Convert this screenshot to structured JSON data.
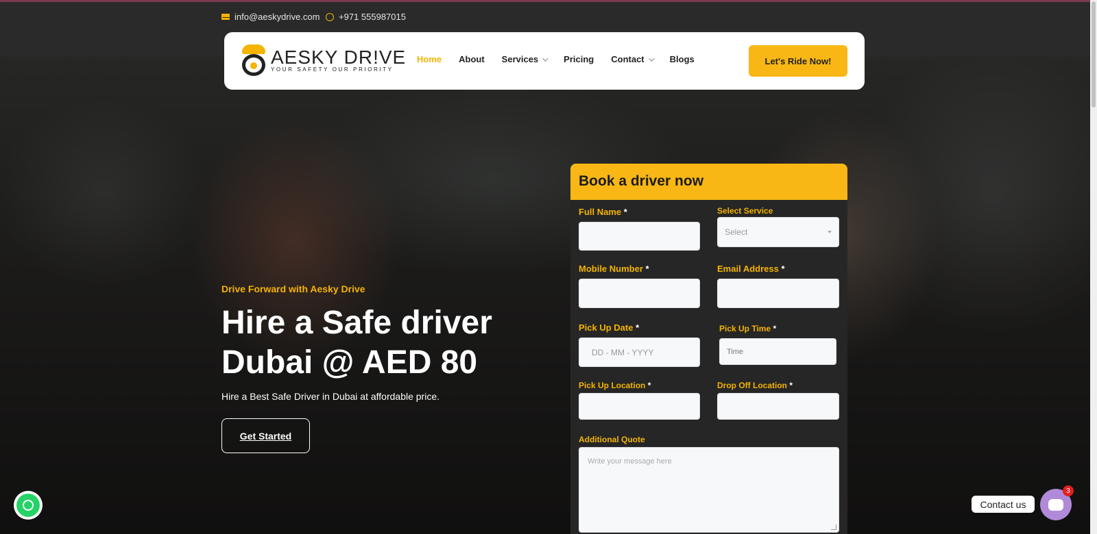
{
  "topbar": {
    "email": "info@aeskydrive.com",
    "phone": "+971 555987015"
  },
  "brand": {
    "name": "AESKY DR!VE",
    "tagline": "YOUR SAFETY OUR PRIORITY"
  },
  "nav": {
    "items": [
      {
        "label": "Home",
        "active": true
      },
      {
        "label": "About"
      },
      {
        "label": "Services"
      },
      {
        "label": "Pricing"
      },
      {
        "label": "Contact"
      },
      {
        "label": "Blogs"
      }
    ],
    "cta": "Let's Ride Now!"
  },
  "hero": {
    "eyebrow": "Drive Forward with Aesky Drive",
    "headline": "Hire a Safe driver Dubai @ AED 80",
    "subtitle": "Hire a Best Safe Driver in Dubai at affordable price.",
    "button": "Get Started"
  },
  "form": {
    "title": "Book a driver now",
    "required_mark": "*",
    "full_name": {
      "label": "Full Name"
    },
    "select_service": {
      "label": "Select Service",
      "value": "Select"
    },
    "mobile": {
      "label": "Mobile Number"
    },
    "email": {
      "label": "Email Address"
    },
    "pickup_date": {
      "label": "Pick Up Date",
      "placeholder": "DD - MM - YYYY"
    },
    "pickup_time": {
      "label": "Pick Up Time",
      "placeholder": "Time"
    },
    "pickup_location": {
      "label": "Pick Up Location"
    },
    "dropoff_location": {
      "label": "Drop Off Location"
    },
    "additional": {
      "label": "Additional Quote",
      "placeholder": "Write your message here"
    }
  },
  "floating": {
    "contact_label": "Contact us",
    "badge_count": "3"
  },
  "colors": {
    "accent": "#f8b714",
    "form_bg": "#262626",
    "chat": "#b08ad8",
    "whatsapp": "#25d366"
  }
}
